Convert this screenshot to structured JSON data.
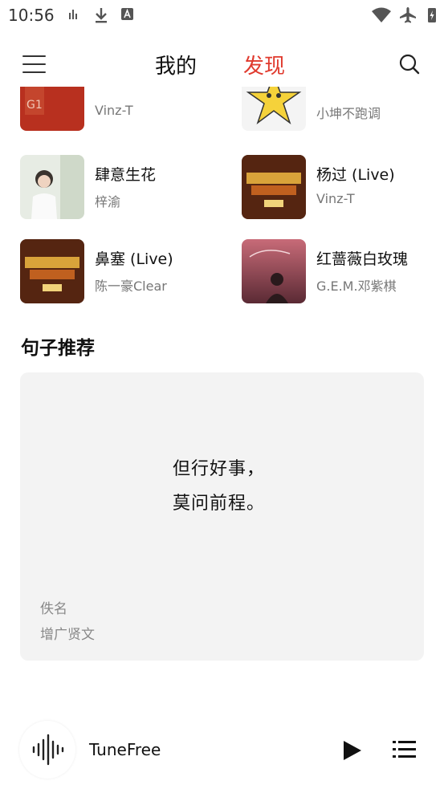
{
  "status_bar": {
    "time": "10:56"
  },
  "header": {
    "tab_mine": "我的",
    "tab_discover": "发现",
    "active_tab": "发现",
    "accent_color": "#e03a2e"
  },
  "songs": [
    {
      "title": "",
      "artist": "Vinz-T",
      "cover": "red-album-cover"
    },
    {
      "title": "",
      "artist": "小坤不跑调",
      "cover": "cartoon-star-cover"
    },
    {
      "title": "肆意生花",
      "artist": "梓渝",
      "cover": "portrait-cover"
    },
    {
      "title": "杨过 (Live)",
      "artist": "Vinz-T",
      "cover": "rap-china-cover"
    },
    {
      "title": "鼻塞 (Live)",
      "artist": "陈一豪Clear",
      "cover": "rap-china-cover"
    },
    {
      "title": "红蔷薇白玫瑰",
      "artist": "G.E.M.邓紫棋",
      "cover": "gloria-cover"
    }
  ],
  "sentence_section": {
    "title": "句子推荐",
    "quote_line1": "但行好事，",
    "quote_line2": "莫问前程。",
    "author": "佚名",
    "source": "增广贤文"
  },
  "player": {
    "title": "TuneFree"
  }
}
